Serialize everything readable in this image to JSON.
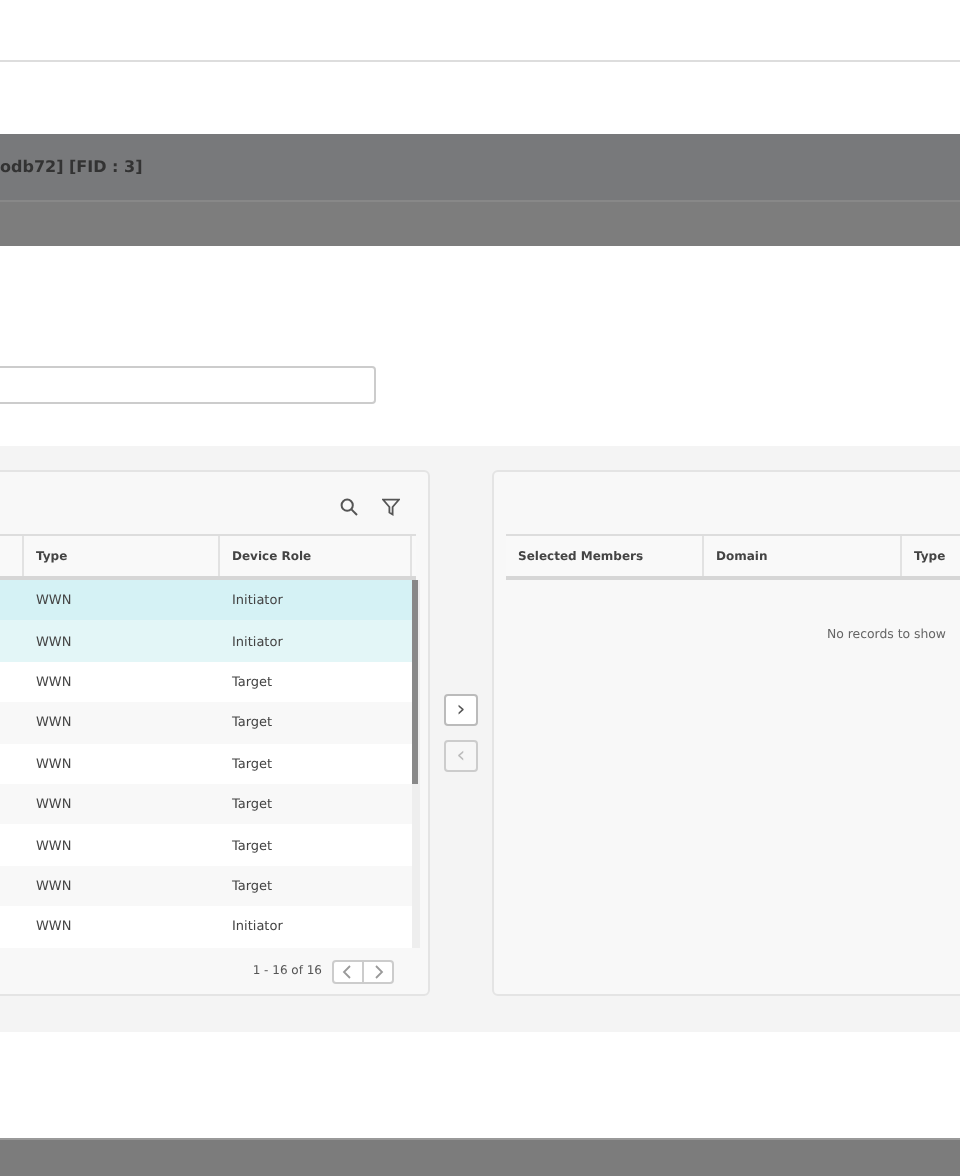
{
  "header_bar": {
    "title": "odb72] [FID : 3]"
  },
  "available_table": {
    "columns": [
      "Type",
      "Device Role"
    ],
    "rows": [
      {
        "type": "WWN",
        "role": "Initiator",
        "selected": true
      },
      {
        "type": "WWN",
        "role": "Initiator",
        "selected": true
      },
      {
        "type": "WWN",
        "role": "Target",
        "selected": false
      },
      {
        "type": "WWN",
        "role": "Target",
        "selected": false
      },
      {
        "type": "WWN",
        "role": "Target",
        "selected": false
      },
      {
        "type": "WWN",
        "role": "Target",
        "selected": false
      },
      {
        "type": "WWN",
        "role": "Target",
        "selected": false
      },
      {
        "type": "WWN",
        "role": "Target",
        "selected": false
      },
      {
        "type": "WWN",
        "role": "Initiator",
        "selected": false
      }
    ],
    "pagination": "1 - 16 of 16"
  },
  "move_buttons": [
    {
      "symbol": "›",
      "disabled": false
    },
    {
      "symbol": "‹",
      "disabled": true
    }
  ],
  "selected_table": {
    "columns": [
      "Selected Members",
      "Domain",
      "Type"
    ],
    "empty_message": "No records to show"
  }
}
